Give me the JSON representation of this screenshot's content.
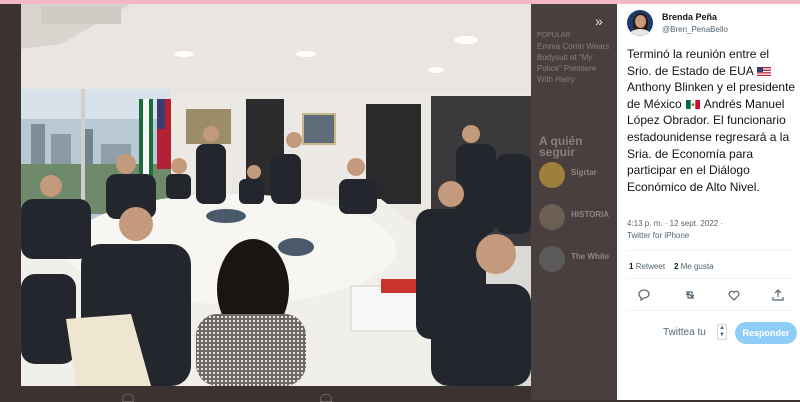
{
  "tweet": {
    "display_name": "Brenda Peña",
    "handle": "@Bren_PenaBello",
    "text_part1": "Terminó la reunión entre el Srio. de Estado de EUA ",
    "text_part2": " Anthony Blinken y el presidente de México ",
    "text_part3": " Andrés Manuel López Obrador. El funcionario estadounidense regresará a la Sria. de Economía para participar en el Diálogo Económico de Alto Nivel.",
    "timestamp": "4:13 p. m. · 12 sept. 2022 ·",
    "source": "Twitter for iPhone",
    "retweets_count": "1",
    "retweets_label": "Retweet",
    "likes_count": "2",
    "likes_label": "Me gusta"
  },
  "reply": {
    "label": "Twittea tu",
    "button_label": "Responder"
  },
  "background": {
    "trending_title": "A quién seguir",
    "item1_label": "POPULAR",
    "item1_text": "Emma Corrin Wears Bodysuit at \"My Police\" Premiere With Harry",
    "who1": "Sigrtar",
    "who2": "HISTORIA",
    "who3": "The White"
  },
  "colors": {
    "accent": "#1d9bf0",
    "reply_button": "#8ecdf7",
    "overlay": "#3d3232"
  },
  "icons": [
    "expand-icon",
    "reply-icon",
    "retweet-icon",
    "like-icon",
    "share-icon",
    "us-flag-icon",
    "mx-flag-icon"
  ]
}
